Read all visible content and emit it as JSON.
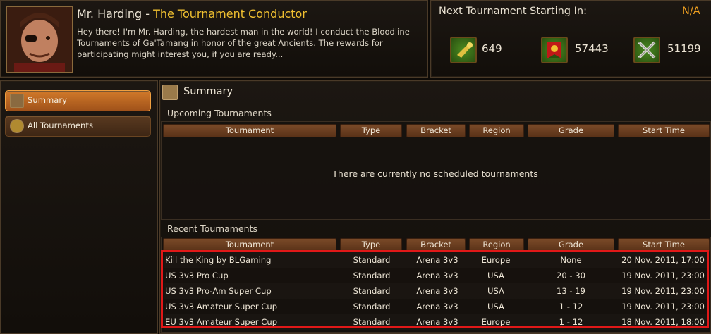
{
  "npc": {
    "name": "Mr. Harding",
    "separator": " - ",
    "title": "The Tournament Conductor",
    "dialog": "Hey there! I'm Mr. Harding, the hardest man in the world! I conduct the Bloodline Tournaments of Ga'Tamang in honor of the great Ancients. The rewards for participating might interest you, if you are ready..."
  },
  "next": {
    "label": "Next Tournament Starting In:",
    "value": "N/A",
    "stats": [
      {
        "icon": "horn-icon",
        "value": "649"
      },
      {
        "icon": "banner-icon",
        "value": "57443"
      },
      {
        "icon": "crossed-swords-icon",
        "value": "51199"
      }
    ]
  },
  "nav": {
    "items": [
      {
        "label": "Summary",
        "icon": "scroll-icon",
        "active": true
      },
      {
        "label": "All Tournaments",
        "icon": "trophy-icon",
        "active": false
      }
    ]
  },
  "main": {
    "title": "Summary",
    "columns": [
      "Tournament",
      "Type",
      "Bracket",
      "Region",
      "Grade",
      "Start Time"
    ],
    "upcoming": {
      "title": "Upcoming Tournaments",
      "empty_message": "There are currently no scheduled tournaments"
    },
    "recent": {
      "title": "Recent Tournaments",
      "rows": [
        {
          "tournament": "Kill the King by BLGaming",
          "type": "Standard",
          "bracket": "Arena 3v3",
          "region": "Europe",
          "grade": "None",
          "start": "20 Nov. 2011, 17:00"
        },
        {
          "tournament": "US 3v3 Pro Cup",
          "type": "Standard",
          "bracket": "Arena 3v3",
          "region": "USA",
          "grade": "20 - 30",
          "start": "19 Nov. 2011, 23:00"
        },
        {
          "tournament": "US 3v3 Pro-Am Super Cup",
          "type": "Standard",
          "bracket": "Arena 3v3",
          "region": "USA",
          "grade": "13 - 19",
          "start": "19 Nov. 2011, 23:00"
        },
        {
          "tournament": "US 3v3 Amateur Super Cup",
          "type": "Standard",
          "bracket": "Arena 3v3",
          "region": "USA",
          "grade": "1 - 12",
          "start": "19 Nov. 2011, 23:00"
        },
        {
          "tournament": "EU 3v3 Amateur Super Cup",
          "type": "Standard",
          "bracket": "Arena 3v3",
          "region": "Europe",
          "grade": "1 - 12",
          "start": "18 Nov. 2011, 18:00"
        }
      ]
    }
  },
  "colors": {
    "accent": "#f0c030",
    "na": "#f0a020",
    "highlight": "#e01818"
  }
}
